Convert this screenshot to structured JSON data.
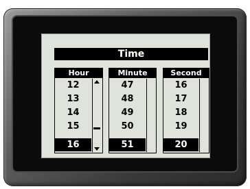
{
  "screen": {
    "title": "Time"
  },
  "columns": [
    {
      "header": "Hour",
      "items": [
        "12",
        "13",
        "14",
        "15",
        "16"
      ],
      "selected": "16",
      "scroll_position_percent": 70
    },
    {
      "header": "Minute",
      "items": [
        "47",
        "48",
        "49",
        "50",
        "51"
      ],
      "selected": "51"
    },
    {
      "header": "Second",
      "items": [
        "16",
        "17",
        "18",
        "19",
        "20"
      ],
      "selected": "20"
    }
  ],
  "colors": {
    "screen_bg": "#dfe3dc",
    "highlight": "#000000",
    "bezel": "#5e5e5e"
  }
}
